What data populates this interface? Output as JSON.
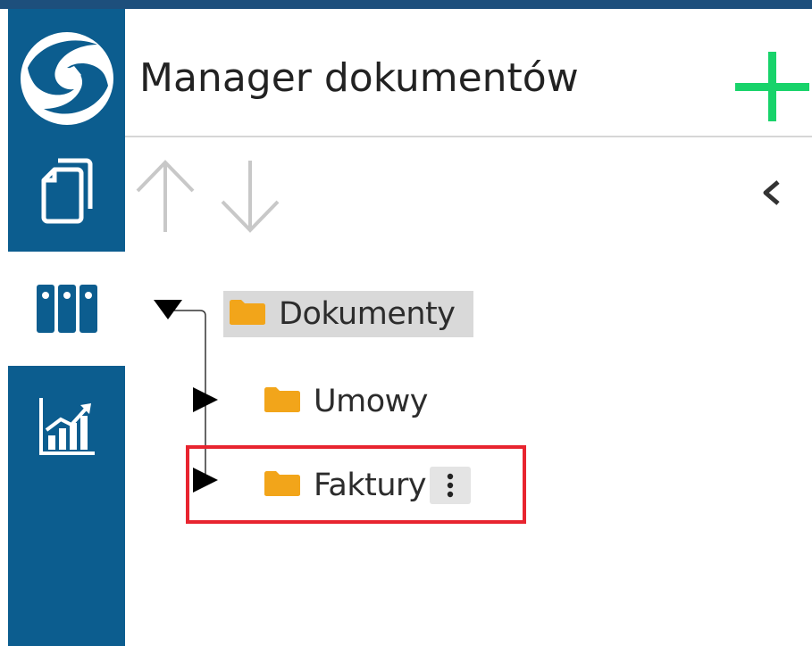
{
  "header": {
    "title": "Manager dokumentów"
  },
  "sidebar": {
    "items": [
      {
        "icon": "documents-icon",
        "active": false
      },
      {
        "icon": "binders-icon",
        "active": true
      },
      {
        "icon": "chart-icon",
        "active": false
      }
    ]
  },
  "toolbar": {
    "move_up_icon": "arrow-up-icon",
    "move_down_icon": "arrow-down-icon",
    "collapse_icon": "chevron-left-icon"
  },
  "tree": {
    "root": {
      "label": "Dokumenty",
      "expanded": true,
      "selected": true
    },
    "children": [
      {
        "label": "Umowy",
        "expanded": false
      },
      {
        "label": "Faktury",
        "expanded": false,
        "highlighted": true
      }
    ]
  },
  "colors": {
    "sidebar": "#0c5d8f",
    "top_strip": "#1d4f7c",
    "add_button": "#18d36a",
    "folder": "#f2a51a",
    "selection": "#d9d9d9",
    "highlight": "#e8242f",
    "disabled_arrow": "#c8c8c8"
  }
}
